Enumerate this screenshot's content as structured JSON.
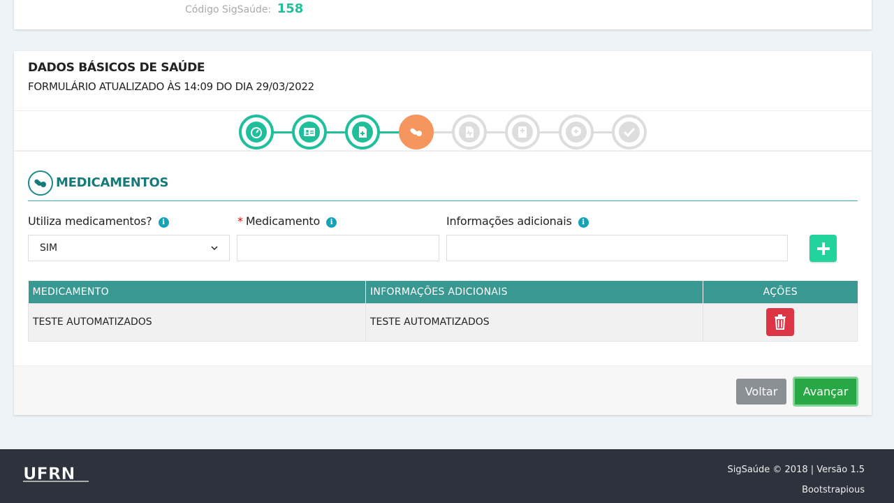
{
  "top": {
    "codigo_label": "Código SigSaúde:",
    "codigo_value": "158"
  },
  "card": {
    "title": "DADOS BÁSICOS DE SAÚDE",
    "subtitle": "FORMULÁRIO ATUALIZADO ÀS 14:09 DO DIA 29/03/2022"
  },
  "stepper": {
    "steps": [
      {
        "icon": "dashboard-gauge-icon",
        "status": "done"
      },
      {
        "icon": "id-card-icon",
        "status": "done"
      },
      {
        "icon": "document-plus-icon",
        "status": "done"
      },
      {
        "icon": "pills-icon",
        "status": "active"
      },
      {
        "icon": "medical-report-icon",
        "status": "pending"
      },
      {
        "icon": "medical-book-icon",
        "status": "pending"
      },
      {
        "icon": "comment-plus-icon",
        "status": "pending"
      },
      {
        "icon": "check-double-icon",
        "status": "pending"
      }
    ],
    "colors": {
      "done": "#1fbf9b",
      "active": "#f6965f",
      "pending": "#dddddd"
    }
  },
  "section": {
    "title": "MEDICAMENTOS",
    "icon": "pills-icon"
  },
  "form": {
    "utiliza_label": "Utiliza medicamentos?",
    "utiliza_value": "SIM",
    "medicamento_required": "*",
    "medicamento_label": "Medicamento",
    "medicamento_value": "",
    "info_label": "Informações adicionais",
    "info_value": "",
    "info_icon_glyph": "i"
  },
  "table": {
    "headers": [
      "MEDICAMENTO",
      "INFORMAÇÕES ADICIONAIS",
      "AÇÕES"
    ],
    "rows": [
      {
        "medicamento": "TESTE AUTOMATIZADOS",
        "informacoes": "TESTE AUTOMATIZADOS"
      }
    ]
  },
  "actions": {
    "voltar": "Voltar",
    "avancar": "Avançar"
  },
  "footer": {
    "logo": "UFRN",
    "copyright": "SigSaúde © 2018 | Versão 1.5",
    "credit": "Bootstrapious"
  }
}
